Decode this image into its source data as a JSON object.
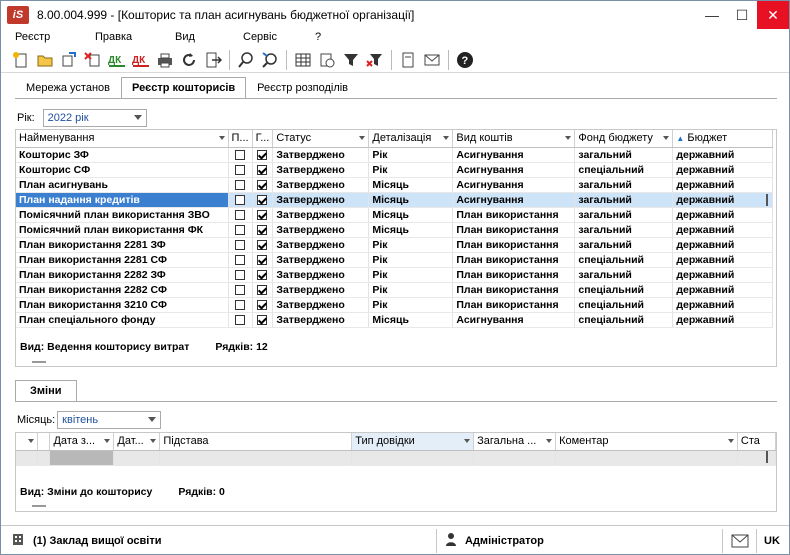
{
  "window": {
    "title": "8.00.004.999 - [Кошторис та план асигнувань бюджетної організації]",
    "logo": "iS"
  },
  "menu": [
    "Реєстр",
    "Правка",
    "Вид",
    "Сервіс",
    "?"
  ],
  "toolbar_icons": [
    "new-icon",
    "open-folder-icon",
    "copy-icon",
    "delete-icon",
    "sign-dk-icon",
    "unsign-dk-icon",
    "print-icon",
    "refresh-icon",
    "export-icon",
    "search-icon",
    "find-next-icon",
    "table-icon",
    "calendar-icon",
    "filter-icon",
    "clear-filter-icon",
    "document-icon",
    "mail-icon",
    "help-icon"
  ],
  "tabs": [
    "Мережа установ",
    "Реєстр кошторисів",
    "Реєстр розподілів"
  ],
  "active_tab": 1,
  "year": {
    "label": "Рік:",
    "value": "2022 рік"
  },
  "grid": {
    "columns": [
      "Найменування",
      "П...",
      "Г...",
      "Статус",
      "Деталізація",
      "Вид коштів",
      "Фонд бюджету",
      "Бюджет"
    ],
    "rows": [
      {
        "name": "Кошторис ЗФ",
        "p": false,
        "g": true,
        "status": "Затверджено",
        "detail": "Рік",
        "kind": "Асигнування",
        "fund": "загальний",
        "budget": "державний"
      },
      {
        "name": "Кошторис СФ",
        "p": false,
        "g": true,
        "status": "Затверджено",
        "detail": "Рік",
        "kind": "Асигнування",
        "fund": "спеціальний",
        "budget": "державний"
      },
      {
        "name": "План асигнувань",
        "p": false,
        "g": true,
        "status": "Затверджено",
        "detail": "Місяць",
        "kind": "Асигнування",
        "fund": "загальний",
        "budget": "державний"
      },
      {
        "name": "План надання кредитів",
        "p": false,
        "g": true,
        "status": "Затверджено",
        "detail": "Місяць",
        "kind": "Асигнування",
        "fund": "загальний",
        "budget": "державний"
      },
      {
        "name": "Помісячний план використання ЗВО",
        "p": false,
        "g": true,
        "status": "Затверджено",
        "detail": "Місяць",
        "kind": "План використання",
        "fund": "загальний",
        "budget": "державний"
      },
      {
        "name": "Помісячний план використання ФК",
        "p": false,
        "g": true,
        "status": "Затверджено",
        "detail": "Місяць",
        "kind": "План використання",
        "fund": "загальний",
        "budget": "державний"
      },
      {
        "name": "План використання 2281 ЗФ",
        "p": false,
        "g": true,
        "status": "Затверджено",
        "detail": "Рік",
        "kind": "План використання",
        "fund": "загальний",
        "budget": "державний"
      },
      {
        "name": "План використання 2281 СФ",
        "p": false,
        "g": true,
        "status": "Затверджено",
        "detail": "Рік",
        "kind": "План використання",
        "fund": "спеціальний",
        "budget": "державний"
      },
      {
        "name": "План використання 2282 ЗФ",
        "p": false,
        "g": true,
        "status": "Затверджено",
        "detail": "Рік",
        "kind": "План використання",
        "fund": "загальний",
        "budget": "державний"
      },
      {
        "name": "План використання 2282 СФ",
        "p": false,
        "g": true,
        "status": "Затверджено",
        "detail": "Рік",
        "kind": "План використання",
        "fund": "спеціальний",
        "budget": "державний"
      },
      {
        "name": "План використання 3210 СФ",
        "p": false,
        "g": true,
        "status": "Затверджено",
        "detail": "Рік",
        "kind": "План використання",
        "fund": "спеціальний",
        "budget": "державний"
      },
      {
        "name": "План спеціального фонду",
        "p": false,
        "g": true,
        "status": "Затверджено",
        "detail": "Місяць",
        "kind": "Асигнування",
        "fund": "спеціальний",
        "budget": "державний"
      }
    ],
    "selected_row": 3,
    "footer_view": "Вид: Ведення кошторису витрат",
    "footer_rows": "Рядків: 12"
  },
  "changes": {
    "tab": "Зміни",
    "month_label": "Місяць:",
    "month_value": "квітень",
    "columns": [
      "",
      "Дата з...",
      "Дат...",
      "Підстава",
      "Тип довідки",
      "Загальна ...",
      "Коментар",
      "Ста"
    ],
    "footer_view": "Вид: Зміни до кошторису",
    "footer_rows": "Рядків: 0"
  },
  "statusbar": {
    "org": "(1) Заклад вищої освіти",
    "user": "Адміністратор",
    "lang": "UK"
  },
  "colors": {
    "selection": "#3b7fd1",
    "selection_row": "#cde3f7",
    "close": "#e81123",
    "accent_blue": "#1f4e9c"
  }
}
